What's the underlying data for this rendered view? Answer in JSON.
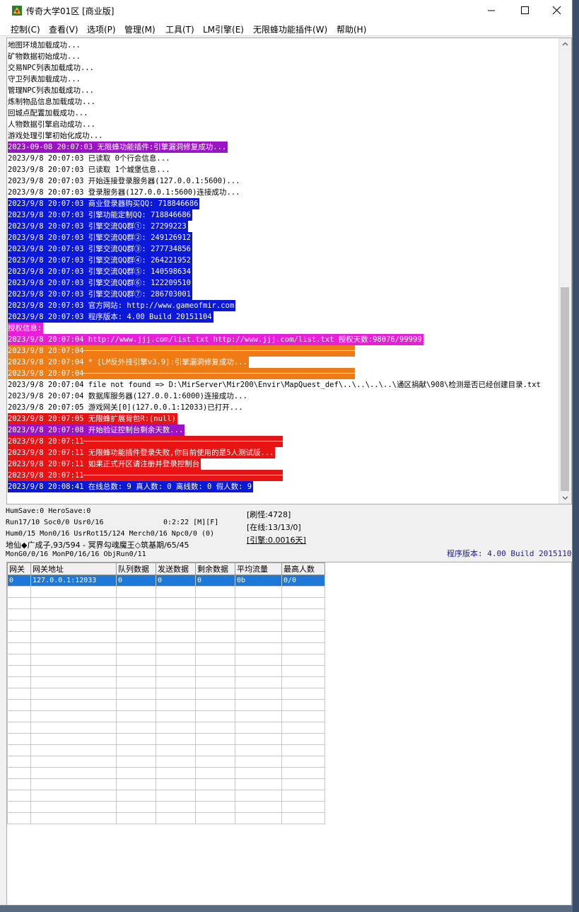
{
  "window": {
    "title": "传奇大学01区 [商业版]",
    "menu": [
      "控制(C)",
      "查看(V)",
      "选项(P)",
      "管理(M)",
      "工具(T)",
      "LM引擎(E)",
      "无限蜂功能插件(W)",
      "帮助(H)"
    ]
  },
  "log": {
    "lines": [
      {
        "text": "地图环境加载成功...",
        "bg": "",
        "fg": "#000000"
      },
      {
        "text": "矿物数据初始成功...",
        "bg": "",
        "fg": "#000000"
      },
      {
        "text": "交易NPC列表加载成功...",
        "bg": "",
        "fg": "#000000"
      },
      {
        "text": "守卫列表加载成功...",
        "bg": "",
        "fg": "#000000"
      },
      {
        "text": "管理NPC列表加载成功...",
        "bg": "",
        "fg": "#000000"
      },
      {
        "text": "炼制物品信息加载成功...",
        "bg": "",
        "fg": "#000000"
      },
      {
        "text": "回城点配置加载成功...",
        "bg": "",
        "fg": "#000000"
      },
      {
        "text": "人物数据引擎启动成功...",
        "bg": "",
        "fg": "#000000"
      },
      {
        "text": "游戏处理引擎初始化成功...",
        "bg": "",
        "fg": "#000000"
      },
      {
        "text": "2023-09-08 20:07:03 无限蜂功能插件:引擎漏洞修复成功...",
        "bg": "#9b12c8",
        "fg": "#ffffff"
      },
      {
        "text": "2023/9/8 20:07:03 已读取 0个行会信息...",
        "bg": "",
        "fg": "#000000"
      },
      {
        "text": "2023/9/8 20:07:03 已读取 1个城堡信息...",
        "bg": "",
        "fg": "#000000"
      },
      {
        "text": "2023/9/8 20:07:03 开始连接登录服务器(127.0.0.1:5600)...",
        "bg": "",
        "fg": "#000000"
      },
      {
        "text": "2023/9/8 20:07:03 登录服务器(127.0.0.1:5600)连接成功...",
        "bg": "",
        "fg": "#000000"
      },
      {
        "text": "2023/9/8 20:07:03 商业登录器购买QQ: 718846686",
        "bg": "#0a18d8",
        "fg": "#ffffff"
      },
      {
        "text": "2023/9/8 20:07:03 引擎功能定制QQ: 718846686",
        "bg": "#0a18d8",
        "fg": "#ffffff"
      },
      {
        "text": "2023/9/8 20:07:03 引擎交流QQ群①: 27299223",
        "bg": "#0a18d8",
        "fg": "#ffffff"
      },
      {
        "text": "2023/9/8 20:07:03 引擎交流QQ群②: 249126912",
        "bg": "#0a18d8",
        "fg": "#ffffff"
      },
      {
        "text": "2023/9/8 20:07:03 引擎交流QQ群③: 277734856",
        "bg": "#0a18d8",
        "fg": "#ffffff"
      },
      {
        "text": "2023/9/8 20:07:03 引擎交流QQ群④: 264221952",
        "bg": "#0a18d8",
        "fg": "#ffffff"
      },
      {
        "text": "2023/9/8 20:07:03 引擎交流QQ群⑤: 140598634",
        "bg": "#0a18d8",
        "fg": "#ffffff"
      },
      {
        "text": "2023/9/8 20:07:03 引擎交流QQ群⑥: 122209510",
        "bg": "#0a18d8",
        "fg": "#ffffff"
      },
      {
        "text": "2023/9/8 20:07:03 引擎交流QQ群⑦: 286703001",
        "bg": "#0a18d8",
        "fg": "#ffffff"
      },
      {
        "text": "2023/9/8 20:07:03 官方网站: http://www.gameofmir.com",
        "bg": "#0a18d8",
        "fg": "#ffffff"
      },
      {
        "text": "2023/9/8 20:07:03 程序版本: 4.00 Build 20151104",
        "bg": "#0a18d8",
        "fg": "#ffffff"
      },
      {
        "text": "授权信息:",
        "bg": "#e81ed8",
        "fg": "#ffffff"
      },
      {
        "text": "2023/9/8 20:07:04 http://www.jjj.com/list.txt http://www.jjj.com/list.txt 授权天数:98076/99999",
        "bg": "#e81ed8",
        "fg": "#ffffff"
      },
      {
        "text": "2023/9/8 20:07:04 ",
        "bg": "#f07a14",
        "fg": "#ffffff",
        "sep": "long"
      },
      {
        "text": "2023/9/8 20:07:04 * [LM反外挂引擎v3.9]:引擎漏洞修复成功...",
        "bg": "#f07a14",
        "fg": "#ffffff"
      },
      {
        "text": "2023/9/8 20:07:04 ",
        "bg": "#f07a14",
        "fg": "#ffffff",
        "sep": "long"
      },
      {
        "text": "2023/9/8 20:07:04 file not found => D:\\MirServer\\Mir200\\Envir\\MapQuest_def\\..\\..\\..\\..\\通区捐献\\908\\检测是否已经创建目录.txt",
        "bg": "",
        "fg": "#000000"
      },
      {
        "text": "2023/9/8 20:07:04 数据库服务器(127.0.0.1:6000)连接成功...",
        "bg": "",
        "fg": "#000000"
      },
      {
        "text": "2023/9/8 20:07:05 游戏网关[0](127.0.0.1:12033)已打开...",
        "bg": "",
        "fg": "#000000"
      },
      {
        "text": "2023/9/8 20:07:05 无限蜂扩展背包R:(null)",
        "bg": "#e81414",
        "fg": "#ffffff"
      },
      {
        "text": "2023/9/8 20:07:08 开始验证控制台剩余天数...",
        "bg": "#9b12c8",
        "fg": "#ffffff"
      },
      {
        "text": "2023/9/8 20:07:11 ",
        "bg": "#e81414",
        "fg": "#ffffff",
        "sep": "short"
      },
      {
        "text": "2023/9/8 20:07:11 无限蜂功能插件登录失败,你目前使用的是5人测试版...",
        "bg": "#e81414",
        "fg": "#ffffff"
      },
      {
        "text": "2023/9/8 20:07:11 如果正式开区请注册并登录控制台",
        "bg": "#e81414",
        "fg": "#ffffff"
      },
      {
        "text": "2023/9/8 20:07:11 ",
        "bg": "#e81414",
        "fg": "#ffffff",
        "sep": "short"
      },
      {
        "text": "2023/9/8 20:08:41 在线总数: 9 真人数: 0 离线数: 0 假人数: 9",
        "bg": "#0a18d8",
        "fg": "#ffffff"
      }
    ]
  },
  "status": {
    "line1": "HumSave:0 HeroSave:0",
    "line2a": "Run17/10 Soc0/0 Usr0/16",
    "line2b": "0:2:22 [M][F]",
    "line3": "Hum0/15 Mon0/16 UsrRot15/124 Merch0/16 Npc0/0 (0)",
    "line4": "地仙◆广成子,93/594 - 冥界勾魂魔王◇筑基期/65/45",
    "line5": "MonG0/0/16 MonP0/16/16 ObjRun0/11",
    "refresh": "[刷怪:4728]",
    "online": "[在线:13/13/0]",
    "engine": "[引擎:0.0016天]",
    "version": "程序版本: 4.00 Build 20151104"
  },
  "grid": {
    "headers": [
      "网关",
      "网关地址",
      "队列数据",
      "发送数据",
      "剩余数据",
      "平均流量",
      "最高人数"
    ],
    "rows": [
      [
        "0",
        "127.0.0.1:12033",
        "0",
        "0",
        "0",
        "0b",
        "0/0"
      ]
    ],
    "empty_rows": 21
  },
  "colors": {
    "purple": "#9b12c8",
    "blue": "#0a18d8",
    "magenta": "#e81ed8",
    "orange": "#f07a14",
    "red": "#e81414",
    "selection": "#1e78d7"
  }
}
